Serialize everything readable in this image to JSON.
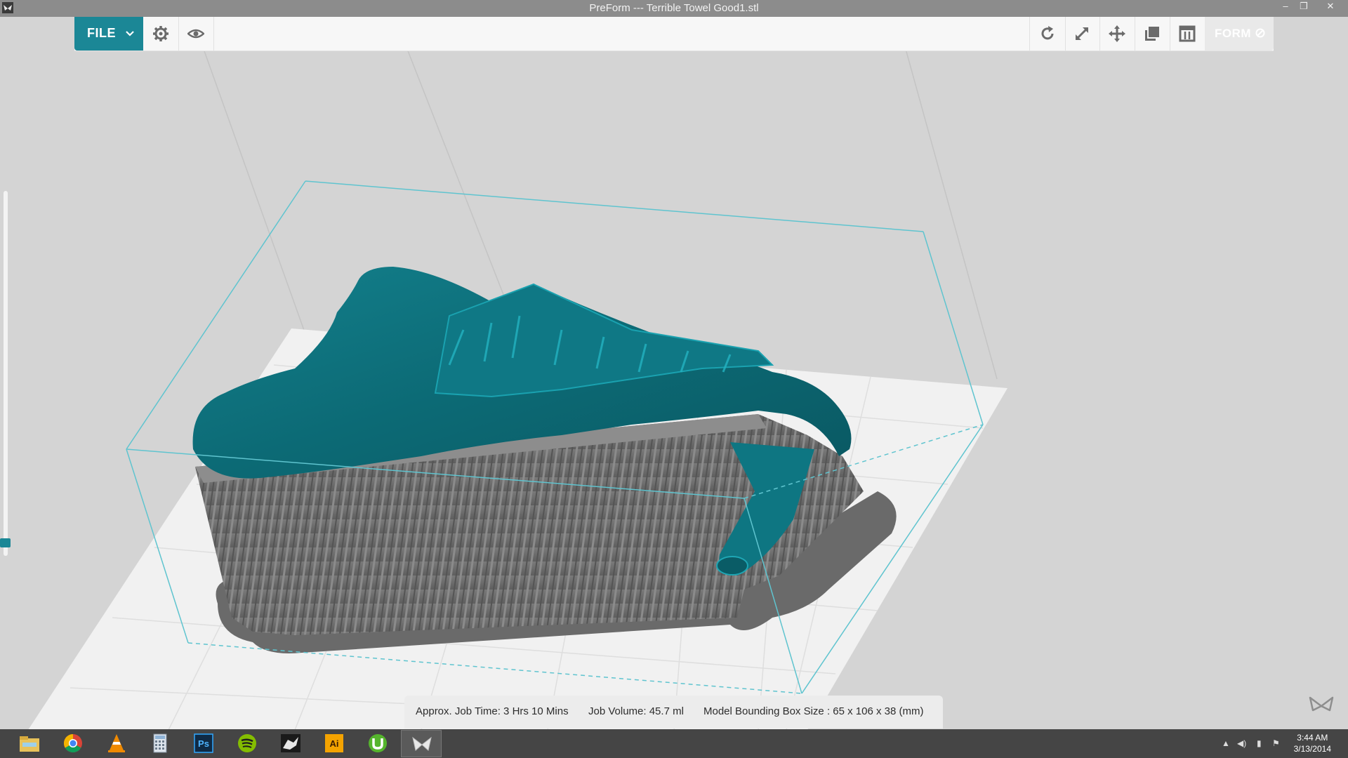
{
  "window": {
    "title": "PreForm --- Terrible Towel Good1.stl",
    "controls": {
      "minimize": "–",
      "restore": "❐",
      "close": "✕"
    }
  },
  "toolbar": {
    "file_label": "FILE",
    "form_label": "FORM",
    "left_icons": [
      "gear-icon",
      "eye-icon"
    ],
    "right_icons": [
      "rotate-icon",
      "scale-icon",
      "move-icon",
      "duplicate-icon",
      "layout-icon"
    ]
  },
  "status": {
    "job_time": "Approx. Job Time: 3 Hrs 10 Mins",
    "job_volume": "Job Volume: 45.7 ml",
    "bounding_box": "Model Bounding Box Size : 65 x 106 x 38  (mm)"
  },
  "taskbar": {
    "apps": [
      "file-explorer",
      "chrome",
      "vlc",
      "calculator",
      "photoshop",
      "spotify",
      "rhino",
      "illustrator",
      "utorrent",
      "preform"
    ],
    "app_labels": {
      "photoshop": "Ps",
      "illustrator": "Ai"
    },
    "active_app": "preform",
    "time": "3:44 AM",
    "date": "3/13/2014"
  },
  "colors": {
    "accent": "#1b8796",
    "model": "#0e6f7a",
    "supports": "#6e6e6e",
    "build_box": "#5fc4cf"
  }
}
